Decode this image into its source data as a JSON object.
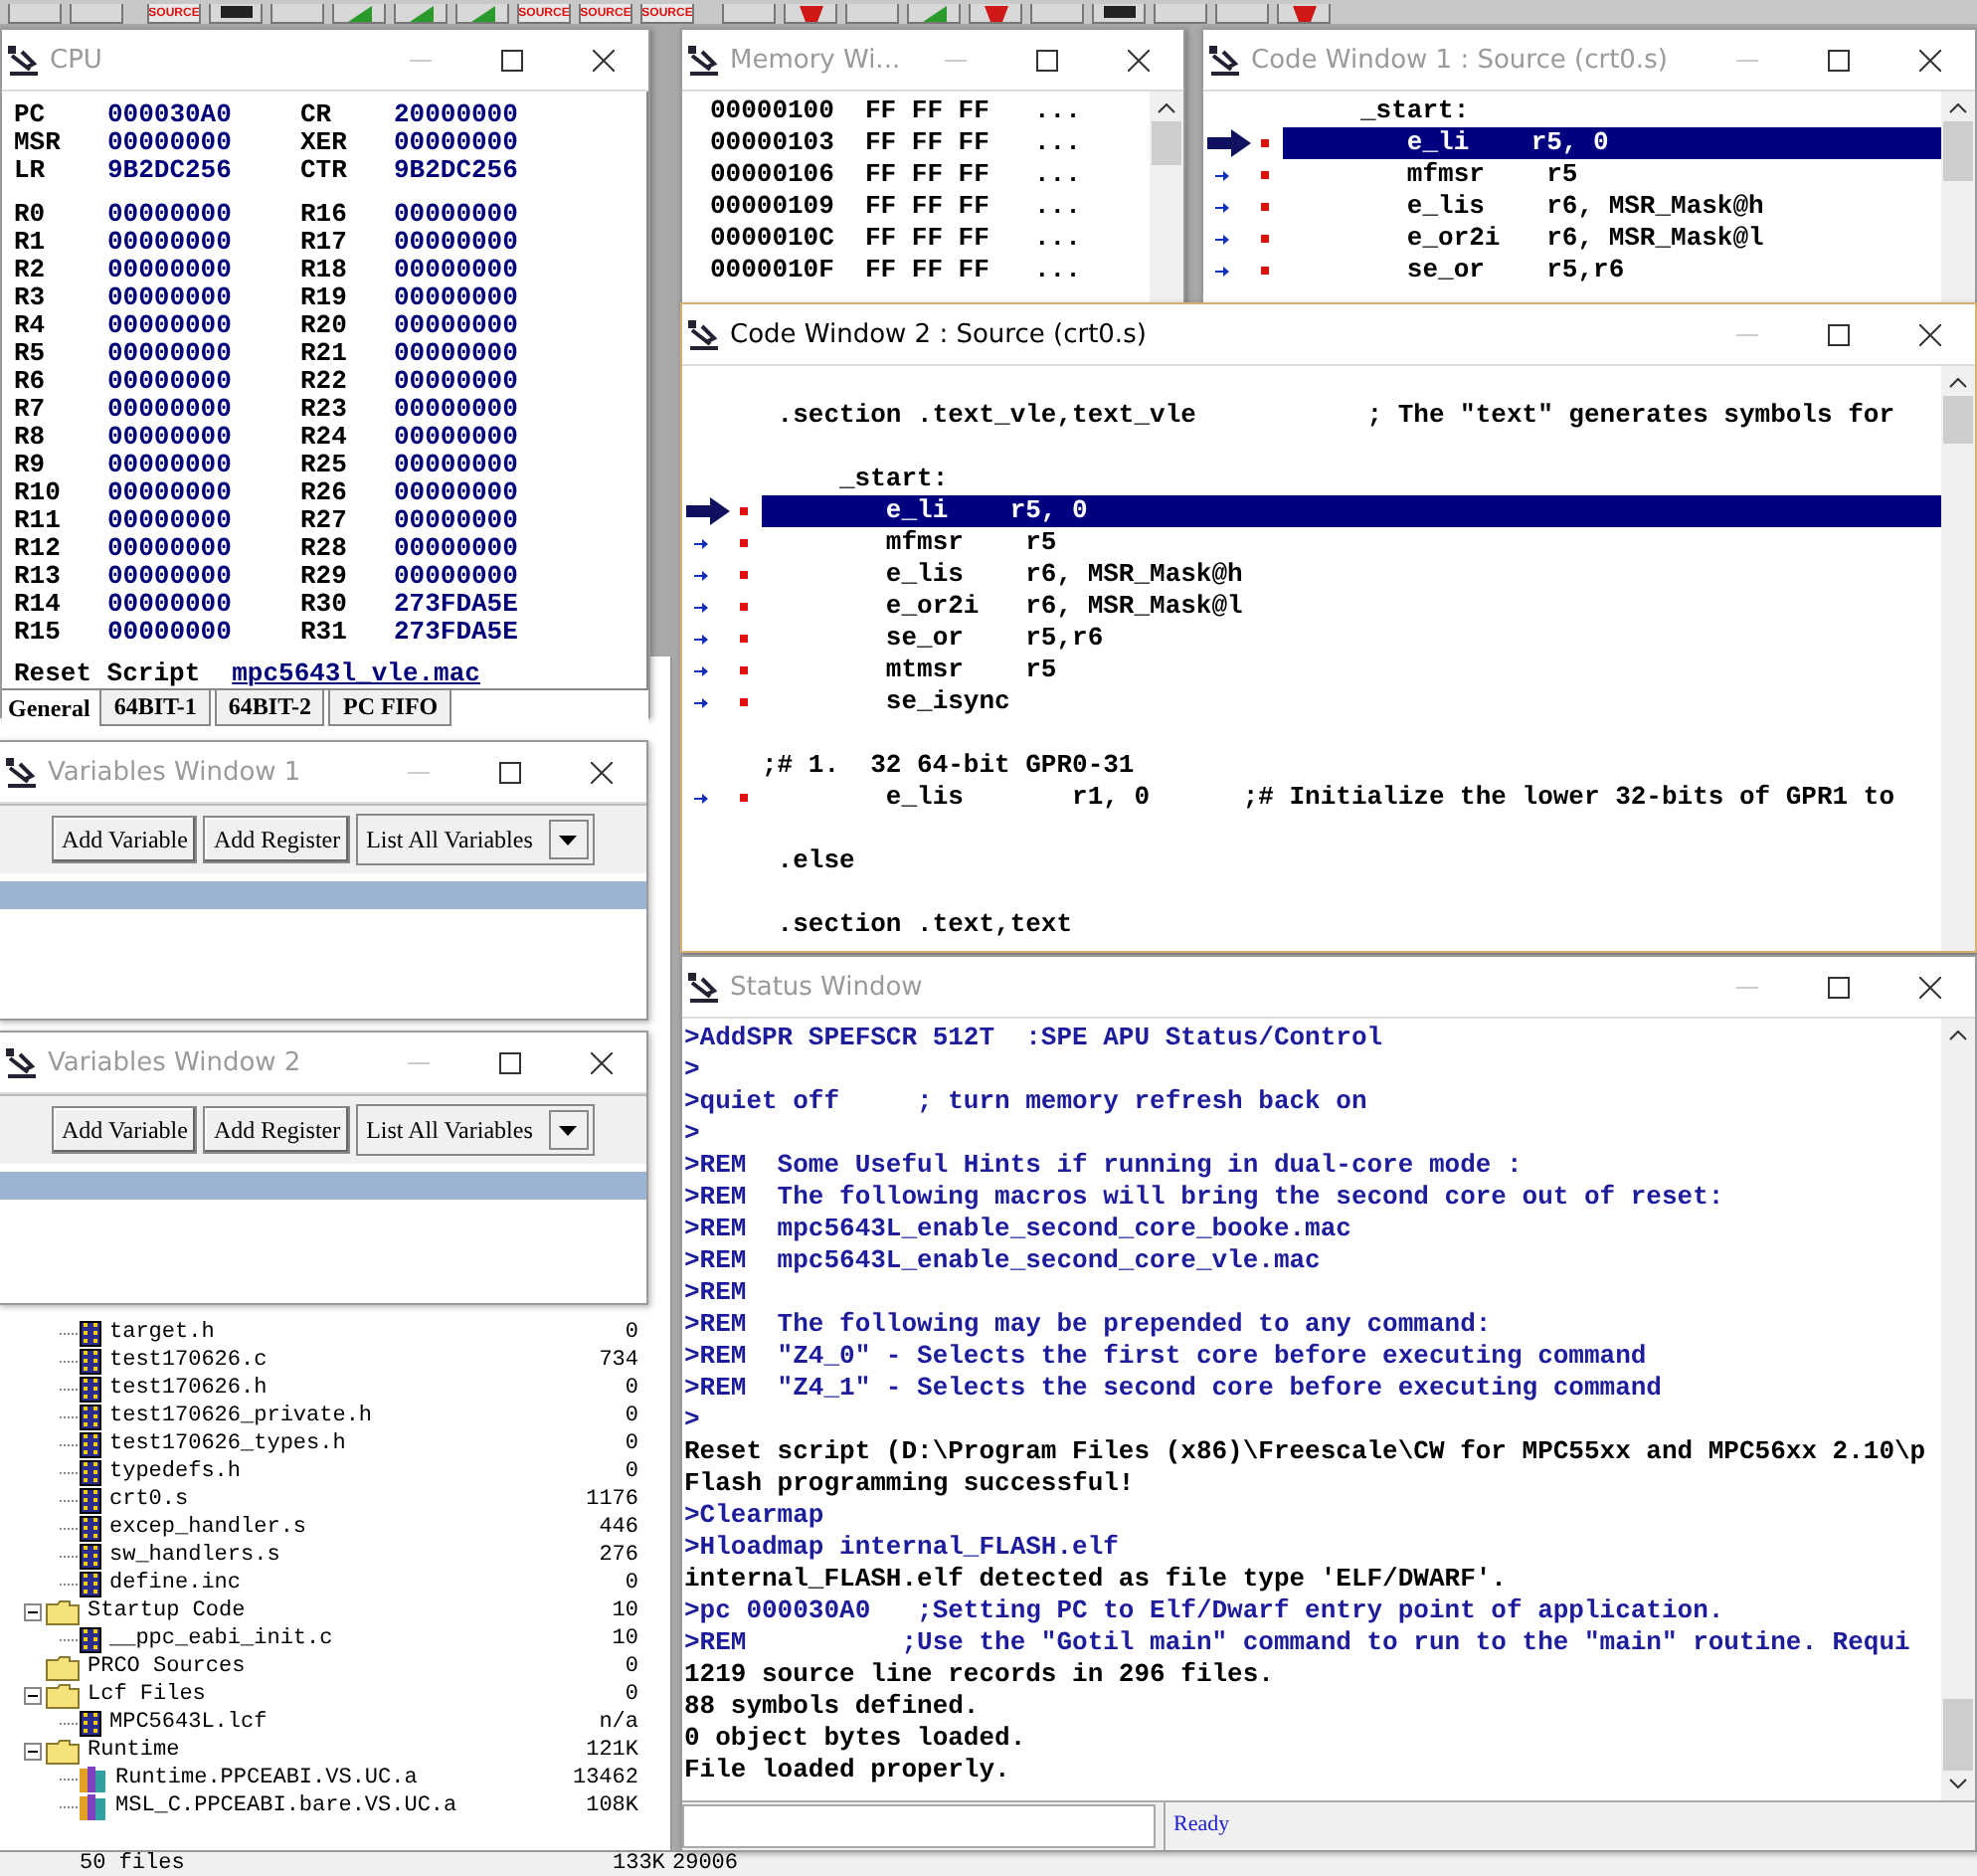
{
  "toolbar": {
    "buttons": [
      {
        "kind": "plain"
      },
      {
        "kind": "plain"
      },
      {
        "kind": "source",
        "label": "SOURCE"
      },
      {
        "kind": "chip"
      },
      {
        "kind": "plain"
      },
      {
        "kind": "run"
      },
      {
        "kind": "run"
      },
      {
        "kind": "run"
      },
      {
        "kind": "source",
        "label": "SOURCE"
      },
      {
        "kind": "source",
        "label": "SOURCE"
      },
      {
        "kind": "source",
        "label": "SOURCE"
      },
      {
        "kind": "plain"
      },
      {
        "kind": "stop"
      },
      {
        "kind": "plain"
      },
      {
        "kind": "run"
      },
      {
        "kind": "stop"
      },
      {
        "kind": "plain"
      },
      {
        "kind": "chip"
      },
      {
        "kind": "plain"
      },
      {
        "kind": "plain"
      },
      {
        "kind": "stop"
      }
    ]
  },
  "cpu_window": {
    "title": "CPU",
    "active": false,
    "special_registers": [
      {
        "name": "PC",
        "value": "000030A0",
        "name2": "CR",
        "value2": "20000000"
      },
      {
        "name": "MSR",
        "value": "00000000",
        "name2": "XER",
        "value2": "00000000"
      },
      {
        "name": "LR",
        "value": "9B2DC256",
        "name2": "CTR",
        "value2": "9B2DC256"
      }
    ],
    "registers": [
      {
        "name": "R0",
        "value": "00000000",
        "name2": "R16",
        "value2": "00000000"
      },
      {
        "name": "R1",
        "value": "00000000",
        "name2": "R17",
        "value2": "00000000"
      },
      {
        "name": "R2",
        "value": "00000000",
        "name2": "R18",
        "value2": "00000000"
      },
      {
        "name": "R3",
        "value": "00000000",
        "name2": "R19",
        "value2": "00000000"
      },
      {
        "name": "R4",
        "value": "00000000",
        "name2": "R20",
        "value2": "00000000"
      },
      {
        "name": "R5",
        "value": "00000000",
        "name2": "R21",
        "value2": "00000000"
      },
      {
        "name": "R6",
        "value": "00000000",
        "name2": "R22",
        "value2": "00000000"
      },
      {
        "name": "R7",
        "value": "00000000",
        "name2": "R23",
        "value2": "00000000"
      },
      {
        "name": "R8",
        "value": "00000000",
        "name2": "R24",
        "value2": "00000000"
      },
      {
        "name": "R9",
        "value": "00000000",
        "name2": "R25",
        "value2": "00000000"
      },
      {
        "name": "R10",
        "value": "00000000",
        "name2": "R26",
        "value2": "00000000"
      },
      {
        "name": "R11",
        "value": "00000000",
        "name2": "R27",
        "value2": "00000000"
      },
      {
        "name": "R12",
        "value": "00000000",
        "name2": "R28",
        "value2": "00000000"
      },
      {
        "name": "R13",
        "value": "00000000",
        "name2": "R29",
        "value2": "00000000"
      },
      {
        "name": "R14",
        "value": "00000000",
        "name2": "R30",
        "value2": "273FDA5E"
      },
      {
        "name": "R15",
        "value": "00000000",
        "name2": "R31",
        "value2": "273FDA5E"
      }
    ],
    "reset_script": {
      "label": "Reset Script",
      "value": "mpc5643l_vle.mac"
    },
    "tabs": [
      {
        "label": "General",
        "selected": true
      },
      {
        "label": "64BIT-1",
        "selected": false
      },
      {
        "label": "64BIT-2",
        "selected": false
      },
      {
        "label": "PC FIFO",
        "selected": false
      }
    ]
  },
  "memory_window": {
    "title": "Memory Wi...",
    "active": false,
    "rows": [
      {
        "address": "00000100",
        "bytes": "FF FF FF",
        "ascii": "..."
      },
      {
        "address": "00000103",
        "bytes": "FF FF FF",
        "ascii": "..."
      },
      {
        "address": "00000106",
        "bytes": "FF FF FF",
        "ascii": "..."
      },
      {
        "address": "00000109",
        "bytes": "FF FF FF",
        "ascii": "..."
      },
      {
        "address": "0000010C",
        "bytes": "FF FF FF",
        "ascii": "..."
      },
      {
        "address": "0000010F",
        "bytes": "FF FF FF",
        "ascii": "..."
      }
    ]
  },
  "code_window_1": {
    "title": "Code Window 1 : Source (crt0.s)",
    "active": false,
    "lines": [
      {
        "kind": "plain",
        "text": "     _start:"
      },
      {
        "kind": "current",
        "text": "        e_li    r5, 0"
      },
      {
        "kind": "step",
        "text": "        mfmsr    r5"
      },
      {
        "kind": "step",
        "text": "        e_lis    r6, MSR_Mask@h"
      },
      {
        "kind": "step",
        "text": "        e_or2i   r6, MSR_Mask@l"
      },
      {
        "kind": "step",
        "text": "        se_or    r5,r6"
      }
    ]
  },
  "code_window_2": {
    "title": "Code Window 2 : Source (crt0.s)",
    "active": true,
    "lines": [
      {
        "kind": "blank"
      },
      {
        "kind": "plain",
        "text": " .section .text_vle,text_vle           ; The \"text\" generates symbols for"
      },
      {
        "kind": "blank"
      },
      {
        "kind": "plain",
        "text": "     _start:"
      },
      {
        "kind": "current",
        "text": "        e_li    r5, 0"
      },
      {
        "kind": "step",
        "text": "        mfmsr    r5"
      },
      {
        "kind": "step",
        "text": "        e_lis    r6, MSR_Mask@h"
      },
      {
        "kind": "step",
        "text": "        e_or2i   r6, MSR_Mask@l"
      },
      {
        "kind": "step",
        "text": "        se_or    r5,r6"
      },
      {
        "kind": "step",
        "text": "        mtmsr    r5"
      },
      {
        "kind": "step",
        "text": "        se_isync"
      },
      {
        "kind": "blank"
      },
      {
        "kind": "plain",
        "text": ";# 1.  32 64-bit GPR0-31"
      },
      {
        "kind": "step",
        "text": "        e_lis       r1, 0      ;# Initialize the lower 32-bits of GPR1 to"
      },
      {
        "kind": "blank"
      },
      {
        "kind": "plain",
        "text": " .else"
      },
      {
        "kind": "blank"
      },
      {
        "kind": "plain",
        "text": " .section .text,text"
      }
    ]
  },
  "variables_windows": [
    {
      "title": "Variables Window 1",
      "active": false,
      "buttons": [
        "Add Variable",
        "Add Register"
      ],
      "dropdown": "List All Variables"
    },
    {
      "title": "Variables Window 2",
      "active": false,
      "buttons": [
        "Add Variable",
        "Add Register"
      ],
      "dropdown": "List All Variables"
    }
  ],
  "project_files": {
    "tree": [
      {
        "children": [
          {
            "kind": "source",
            "name": "target.h",
            "size": "0"
          },
          {
            "kind": "source",
            "name": "test170626.c",
            "size": "734"
          },
          {
            "kind": "source",
            "name": "test170626.h",
            "size": "0"
          },
          {
            "kind": "source",
            "name": "test170626_private.h",
            "size": "0"
          },
          {
            "kind": "source",
            "name": "test170626_types.h",
            "size": "0"
          },
          {
            "kind": "source",
            "name": "typedefs.h",
            "size": "0"
          },
          {
            "kind": "source",
            "name": "crt0.s",
            "size": "1176"
          },
          {
            "kind": "source",
            "name": "excep_handler.s",
            "size": "446"
          },
          {
            "kind": "source",
            "name": "sw_handlers.s",
            "size": "276"
          },
          {
            "kind": "source",
            "name": "define.inc",
            "size": "0"
          }
        ]
      },
      {
        "kind": "group",
        "name": "Startup Code",
        "size": "10",
        "expanded": true,
        "children": [
          {
            "kind": "source",
            "name": "__ppc_eabi_init.c",
            "size": "10"
          }
        ]
      },
      {
        "kind": "group",
        "name": "PRCO Sources",
        "size": "0"
      },
      {
        "kind": "group",
        "name": "Lcf Files",
        "size": "0",
        "expanded": true,
        "children": [
          {
            "kind": "source",
            "name": "MPC5643L.lcf",
            "size": "n/a"
          }
        ]
      },
      {
        "kind": "group",
        "name": "Runtime",
        "size": "121K",
        "expanded": true,
        "children": [
          {
            "kind": "library",
            "name": "Runtime.PPCEABI.VS.UC.a",
            "size": "13462"
          },
          {
            "kind": "library",
            "name": "MSL_C.PPCEABI.bare.VS.UC.a",
            "size": "108K"
          }
        ]
      }
    ],
    "footer": {
      "files": "50 files",
      "size": "133K",
      "column_3": "29006"
    }
  },
  "status_window": {
    "title": "Status Window",
    "active": false,
    "lines": [
      {
        "kind": "command",
        "text": ">AddSPR SPEFSCR 512T  :SPE APU Status/Control"
      },
      {
        "kind": "command",
        "text": ">"
      },
      {
        "kind": "command",
        "text": ">quiet off     ; turn memory refresh back on"
      },
      {
        "kind": "command",
        "text": ">"
      },
      {
        "kind": "command",
        "text": ">REM  Some Useful Hints if running in dual-core mode :"
      },
      {
        "kind": "command",
        "text": ">REM  The following macros will bring the second core out of reset:"
      },
      {
        "kind": "command",
        "text": ">REM  mpc5643L_enable_second_core_booke.mac"
      },
      {
        "kind": "command",
        "text": ">REM  mpc5643L_enable_second_core_vle.mac"
      },
      {
        "kind": "command",
        "text": ">REM"
      },
      {
        "kind": "command",
        "text": ">REM  The following may be prepended to any command:"
      },
      {
        "kind": "command",
        "text": ">REM  \"Z4_0\" - Selects the first core before executing command"
      },
      {
        "kind": "command",
        "text": ">REM  \"Z4_1\" - Selects the second core before executing command"
      },
      {
        "kind": "command",
        "text": ">"
      },
      {
        "kind": "output",
        "text": "Reset script (D:\\Program Files (x86)\\Freescale\\CW for MPC55xx and MPC56xx 2.10\\p"
      },
      {
        "kind": "output",
        "text": "Flash programming successful!"
      },
      {
        "kind": "command",
        "text": ">Clearmap"
      },
      {
        "kind": "command",
        "text": ">Hloadmap internal_FLASH.elf"
      },
      {
        "kind": "output",
        "text": "internal_FLASH.elf detected as file type 'ELF/DWARF'."
      },
      {
        "kind": "command",
        "text": ">pc 000030A0   ;Setting PC to Elf/Dwarf entry point of application."
      },
      {
        "kind": "command",
        "text": ">REM          ;Use the \"Gotil main\" command to run to the \"main\" routine. Requi"
      },
      {
        "kind": "output",
        "text": "1219 source line records in 296 files."
      },
      {
        "kind": "output",
        "text": "88 symbols defined."
      },
      {
        "kind": "output",
        "text": "0 object bytes loaded."
      },
      {
        "kind": "output",
        "text": "File loaded properly."
      }
    ],
    "status": "Ready"
  }
}
